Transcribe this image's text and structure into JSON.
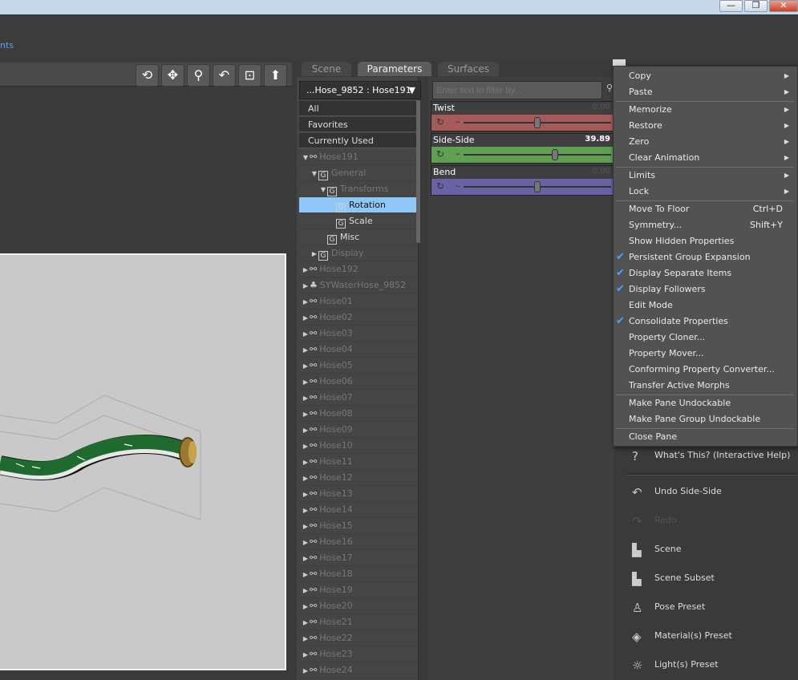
{
  "window": {
    "minimize": "—",
    "restore": "❐",
    "close": "✕"
  },
  "menu": {
    "partial_text": "nts"
  },
  "viewport": {
    "tools": [
      "orbit-icon",
      "move-icon",
      "zoom-icon",
      "rotate-icon",
      "frame-icon",
      "home-icon"
    ]
  },
  "tabs": [
    {
      "label": "Scene",
      "active": false
    },
    {
      "label": "Parameters",
      "active": true
    },
    {
      "label": "Surfaces",
      "active": false
    }
  ],
  "node_selector": {
    "value": "...Hose_9852 : Hose191",
    "arrow": "▼"
  },
  "groups": [
    "All",
    "Favorites",
    "Currently Used"
  ],
  "tree": [
    {
      "label": "Hose191",
      "icon": "bone",
      "arrow": "▼",
      "indent": 0,
      "bright": false
    },
    {
      "label": "General",
      "icon": "G",
      "arrow": "▼",
      "indent": 1,
      "bright": false
    },
    {
      "label": "Transforms",
      "icon": "G",
      "arrow": "▼",
      "indent": 2,
      "bright": false
    },
    {
      "label": "Rotation",
      "icon": "G",
      "arrow": "",
      "indent": 3,
      "bright": false,
      "selected": true
    },
    {
      "label": "Scale",
      "icon": "G",
      "arrow": "",
      "indent": 3,
      "bright": true
    },
    {
      "label": "Misc",
      "icon": "G",
      "arrow": "",
      "indent": 2,
      "bright": true
    },
    {
      "label": "Display",
      "icon": "G",
      "arrow": "▶",
      "indent": 1,
      "bright": false
    },
    {
      "label": "Hose192",
      "icon": "bone",
      "arrow": "▶",
      "indent": 0
    },
    {
      "label": "SYWaterHose_9852",
      "icon": "figure",
      "arrow": "▶",
      "indent": 0
    },
    {
      "label": "Hose01",
      "icon": "bone",
      "arrow": "▶",
      "indent": 0
    },
    {
      "label": "Hose02",
      "icon": "bone",
      "arrow": "▶",
      "indent": 0
    },
    {
      "label": "Hose03",
      "icon": "bone",
      "arrow": "▶",
      "indent": 0
    },
    {
      "label": "Hose04",
      "icon": "bone",
      "arrow": "▶",
      "indent": 0
    },
    {
      "label": "Hose05",
      "icon": "bone",
      "arrow": "▶",
      "indent": 0
    },
    {
      "label": "Hose06",
      "icon": "bone",
      "arrow": "▶",
      "indent": 0
    },
    {
      "label": "Hose07",
      "icon": "bone",
      "arrow": "▶",
      "indent": 0
    },
    {
      "label": "Hose08",
      "icon": "bone",
      "arrow": "▶",
      "indent": 0
    },
    {
      "label": "Hose09",
      "icon": "bone",
      "arrow": "▶",
      "indent": 0
    },
    {
      "label": "Hose10",
      "icon": "bone",
      "arrow": "▶",
      "indent": 0
    },
    {
      "label": "Hose11",
      "icon": "bone",
      "arrow": "▶",
      "indent": 0
    },
    {
      "label": "Hose12",
      "icon": "bone",
      "arrow": "▶",
      "indent": 0
    },
    {
      "label": "Hose13",
      "icon": "bone",
      "arrow": "▶",
      "indent": 0
    },
    {
      "label": "Hose14",
      "icon": "bone",
      "arrow": "▶",
      "indent": 0
    },
    {
      "label": "Hose15",
      "icon": "bone",
      "arrow": "▶",
      "indent": 0
    },
    {
      "label": "Hose16",
      "icon": "bone",
      "arrow": "▶",
      "indent": 0
    },
    {
      "label": "Hose17",
      "icon": "bone",
      "arrow": "▶",
      "indent": 0
    },
    {
      "label": "Hose18",
      "icon": "bone",
      "arrow": "▶",
      "indent": 0
    },
    {
      "label": "Hose19",
      "icon": "bone",
      "arrow": "▶",
      "indent": 0
    },
    {
      "label": "Hose20",
      "icon": "bone",
      "arrow": "▶",
      "indent": 0
    },
    {
      "label": "Hose21",
      "icon": "bone",
      "arrow": "▶",
      "indent": 0
    },
    {
      "label": "Hose22",
      "icon": "bone",
      "arrow": "▶",
      "indent": 0
    },
    {
      "label": "Hose23",
      "icon": "bone",
      "arrow": "▶",
      "indent": 0
    },
    {
      "label": "Hose24",
      "icon": "bone",
      "arrow": "▶",
      "indent": 0
    }
  ],
  "filter": {
    "placeholder": "Enter text to filter by..."
  },
  "sliders": [
    {
      "label": "Twist",
      "value": "0.00",
      "fraction": 0.5,
      "color": "#a75a5a"
    },
    {
      "label": "Side-Side",
      "value": "39.89",
      "fraction": 0.62,
      "color": "#5f9f52"
    },
    {
      "label": "Bend",
      "value": "0.00",
      "fraction": 0.5,
      "color": "#6a62a6"
    }
  ],
  "context_menu": [
    {
      "label": "Copy",
      "submenu": true
    },
    {
      "label": "Paste",
      "submenu": true
    },
    {
      "sep": true
    },
    {
      "label": "Memorize",
      "submenu": true
    },
    {
      "label": "Restore",
      "submenu": true
    },
    {
      "label": "Zero",
      "submenu": true
    },
    {
      "label": "Clear Animation",
      "submenu": true
    },
    {
      "sep": true
    },
    {
      "label": "Limits",
      "submenu": true
    },
    {
      "label": "Lock",
      "submenu": true
    },
    {
      "sep": true
    },
    {
      "label": "Move To Floor",
      "shortcut": "Ctrl+D"
    },
    {
      "label": "Symmetry...",
      "shortcut": "Shift+Y"
    },
    {
      "label": "Show Hidden Properties"
    },
    {
      "label": "Persistent Group Expansion",
      "checked": true
    },
    {
      "label": "Display Separate Items",
      "checked": true
    },
    {
      "label": "Display Followers",
      "checked": true
    },
    {
      "label": "Edit Mode"
    },
    {
      "label": "Consolidate Properties",
      "checked": true
    },
    {
      "label": "Property Cloner..."
    },
    {
      "label": "Property Mover..."
    },
    {
      "label": "Conforming Property Converter..."
    },
    {
      "label": "Transfer Active Morphs"
    },
    {
      "sep": true
    },
    {
      "label": "Make Pane Undockable"
    },
    {
      "label": "Make Pane Group Undockable"
    },
    {
      "sep": true
    },
    {
      "label": "Close Pane"
    }
  ],
  "right_pane": {
    "whats_this": "What's This? (Interactive Help)",
    "undo": "Undo Side-Side",
    "redo": "Redo",
    "items": [
      "Scene",
      "Scene Subset",
      "Pose Preset",
      "Material(s) Preset",
      "Light(s) Preset"
    ]
  }
}
